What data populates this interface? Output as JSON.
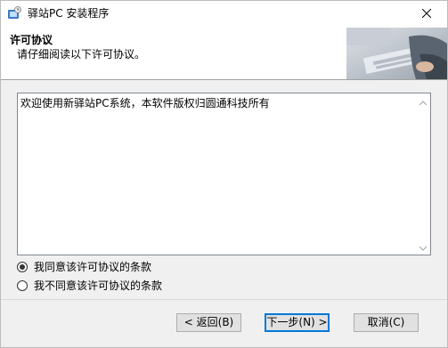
{
  "window": {
    "title": "驿站PC 安装程序",
    "close_icon": "close-icon"
  },
  "header": {
    "title": "许可协议",
    "subtitle": "请仔细阅读以下许可协议。"
  },
  "license": {
    "text": "欢迎使用新驿站PC系统，本软件版权归圆通科技所有"
  },
  "options": {
    "agree_label": "我同意该许可协议的条款",
    "disagree_label": "我不同意该许可协议的条款",
    "selected": "agree"
  },
  "buttons": {
    "back_label": "< 返回(B)",
    "next_label": "下一步(N) >",
    "cancel_label": "取消(C)"
  }
}
